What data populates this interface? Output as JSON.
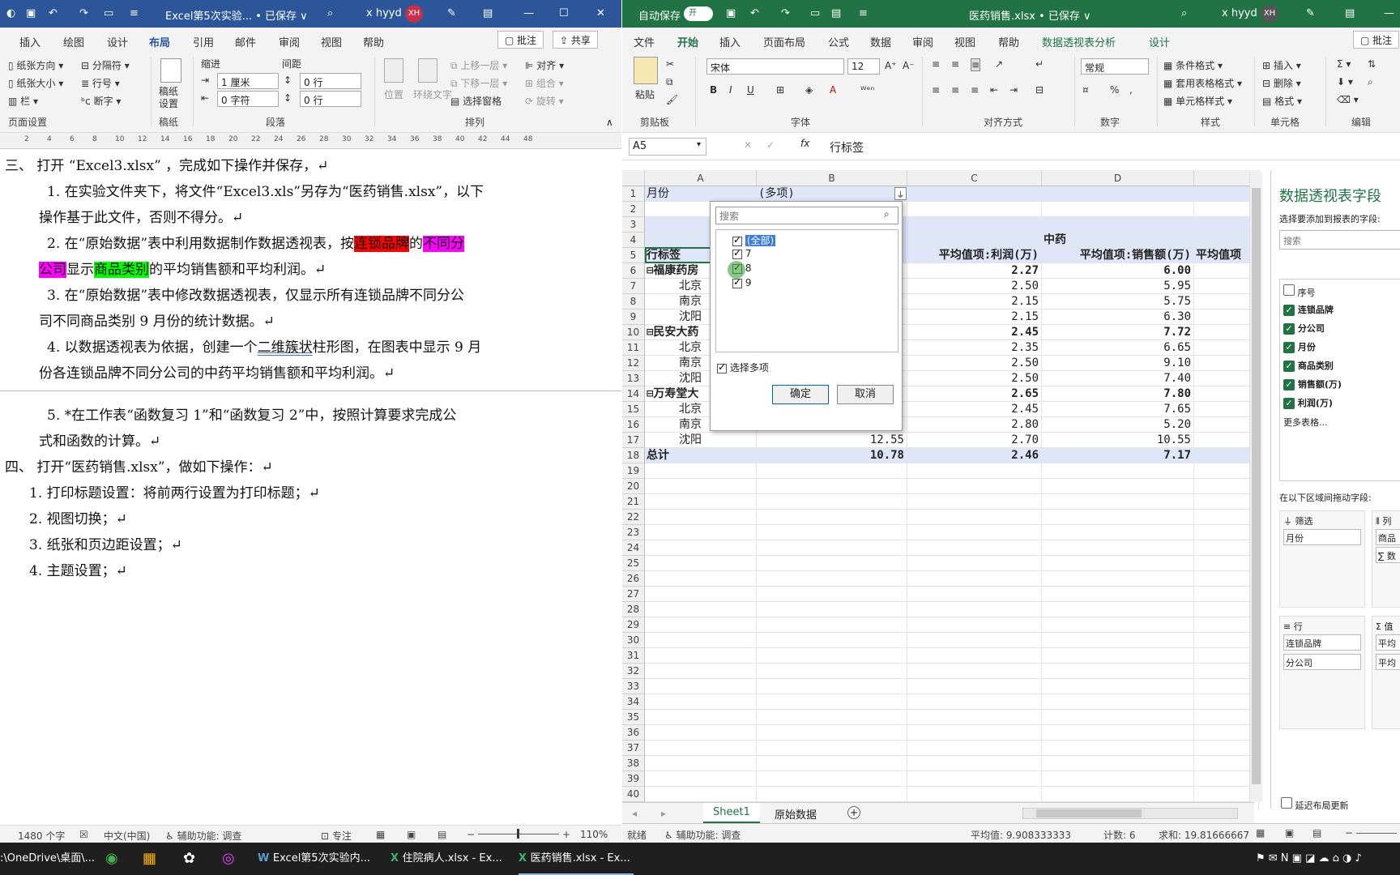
{
  "word": {
    "title": "Excel第5次实验... • 已保存 ∨",
    "user": "x hyyd",
    "avatar": "XH",
    "tabs": [
      "插入",
      "绘图",
      "设计",
      "布局",
      "引用",
      "邮件",
      "审阅",
      "视图",
      "帮助"
    ],
    "active_tab": "布局",
    "comment_btn": "批注",
    "share_btn": "共享",
    "ribbon": {
      "paper_orientation": "纸张方向",
      "paper_size": "纸张大小",
      "columns": "栏",
      "breaks": "分隔符",
      "line_numbers": "行号",
      "hyphenation": "断字",
      "manuscript": "稿纸设置",
      "indent": "缩进",
      "spacing": "间距",
      "indent_left": "1 厘米",
      "indent_right": "0 字符",
      "space_before": "0 行",
      "space_after": "0 行",
      "position": "位置",
      "wrap": "环绕文字",
      "bring_forward": "上移一层",
      "send_backward": "下移一层",
      "selection_pane": "选择窗格",
      "align": "对齐",
      "group": "组合",
      "rotate": "旋转",
      "groups": [
        "页面设置",
        "稿纸",
        "段落",
        "排列"
      ]
    },
    "ruler_ticks": [
      "2",
      "4",
      "6",
      "8",
      "10",
      "12",
      "14",
      "16",
      "18",
      "20",
      "22",
      "24",
      "26",
      "28",
      "30",
      "32",
      "34",
      "36",
      "38",
      "40",
      "42",
      "44",
      "48"
    ],
    "doc": {
      "l1": "三、   打开 “Excel3.xlsx” ，完成如下操作并保存，↵",
      "l2": "1.   在实验文件夹下，将文件“Excel3.xls”另存为“医药销售.xlsx”，以下",
      "l3": "操作基于此文件，否则不得分。↵",
      "l4a": "2.   在“原始数据”表中利用数据制作数据透视表，按",
      "l4b": "连锁品牌",
      "l4c": "的",
      "l4d": "不同分",
      "l5a": "公司",
      "l5b": "显示",
      "l5c": "商品类别",
      "l5d": "的平均销售额和平均利润。↵",
      "l6": "3.   在“原始数据”表中修改数据透视表，仅显示所有连锁品牌不同分公",
      "l7": "司不同商品类别 9 月份的统计数据。↵",
      "l8a": "4.   以数据透视表为依据，创建一个",
      "l8b": "二维簇状",
      "l8c": "柱形图，在图表中显示 9 月",
      "l9": "份各连锁品牌不同分公司的中药平均销售额和平均利润。↵",
      "l10": "5.   *在工作表“函数复习 1”和“函数复习 2”中，按照计算要求完成公",
      "l11": "式和函数的计算。↵",
      "l12": "四、   打开“医药销售.xlsx”，做如下操作：↵",
      "l13": "1.   打印标题设置：将前两行设置为打印标题；↵",
      "l14": "2.   视图切换；↵",
      "l15": "3.   纸张和页边距设置；↵",
      "l16": "4.   主题设置；↵"
    },
    "status": {
      "words": "1480 个字",
      "lang": "中文(中国)",
      "accessibility": "辅助功能: 调查",
      "focus": "专注",
      "zoom": "110%"
    }
  },
  "excel": {
    "autosave": "自动保存",
    "autosave_state": "开",
    "title": "医药销售.xlsx • 已保存 ∨",
    "user": "x hyyd",
    "avatar": "XH",
    "tabs": [
      "文件",
      "开始",
      "插入",
      "页面布局",
      "公式",
      "数据",
      "审阅",
      "视图",
      "帮助",
      "数据透视表分析",
      "设计"
    ],
    "active_tab": "开始",
    "comment_btn": "批注",
    "ribbon": {
      "paste": "粘贴",
      "clipboard": "剪贴板",
      "font_name": "宋体",
      "font_size": "12",
      "font_group": "字体",
      "align_group": "对齐方式",
      "number_format": "常规",
      "number_group": "数字",
      "cond_format": "条件格式",
      "table_format": "套用表格格式",
      "cell_style": "单元格样式",
      "style_group": "样式",
      "insert": "插入",
      "delete": "删除",
      "format": "格式",
      "cells_group": "单元格",
      "edit_group": "编辑"
    },
    "name_box": "A5",
    "formula": "行标签",
    "columns": [
      "A",
      "B",
      "C",
      "D"
    ],
    "rows": [
      "1",
      "2",
      "3",
      "4",
      "5",
      "6",
      "7",
      "8",
      "9",
      "10",
      "11",
      "12",
      "13",
      "14",
      "15",
      "16",
      "17",
      "18",
      "19",
      "20",
      "21",
      "22",
      "23",
      "24",
      "25",
      "26",
      "27",
      "28",
      "29",
      "30",
      "31",
      "32",
      "33",
      "34",
      "35",
      "36",
      "37",
      "38",
      "39",
      "40"
    ],
    "cells": {
      "a1": "月份",
      "b1": "(多项)",
      "d4": "中药",
      "a5": "行标签",
      "c5": "平均值项:利润(万)",
      "d5": "平均值项:销售额(万)",
      "e5": "平均值项",
      "a6": "⊟福康药房",
      "c6": "2.27",
      "d6": "6.00",
      "a7": "北京",
      "c7": "2.50",
      "d7": "5.95",
      "a8": "南京",
      "c8": "2.15",
      "d8": "5.75",
      "a9": "沈阳",
      "c9": "2.15",
      "d9": "6.30",
      "a10": "⊟民安大药",
      "c10": "2.45",
      "d10": "7.72",
      "a11": "北京",
      "c11": "2.35",
      "d11": "6.65",
      "a12": "南京",
      "c12": "2.50",
      "d12": "9.10",
      "a13": "沈阳",
      "c13": "2.50",
      "d13": "7.40",
      "a14": "⊟万寿堂大",
      "c14": "2.65",
      "d14": "7.80",
      "a15": "北京",
      "c15": "2.45",
      "d15": "7.65",
      "a16": "南京",
      "c16": "2.80",
      "d16": "5.20",
      "a17": "沈阳",
      "b17": "12.55",
      "c17": "2.70",
      "d17": "10.55",
      "a18": "总计",
      "b18": "10.78",
      "c18": "2.46",
      "d18": "7.17"
    },
    "filter": {
      "search_placeholder": "搜索",
      "items": [
        {
          "label": "(全部)",
          "checked": true
        },
        {
          "label": "7",
          "checked": true
        },
        {
          "label": "8",
          "checked": true
        },
        {
          "label": "9",
          "checked": true
        }
      ],
      "multi_select": "选择多项",
      "ok": "确定",
      "cancel": "取消"
    },
    "sheets": [
      "Sheet1",
      "原始数据"
    ],
    "active_sheet": "Sheet1",
    "pivot_pane": {
      "title": "数据透视表字段",
      "subtitle": "选择要添加到报表的字段:",
      "search": "搜索",
      "fields": [
        {
          "label": "序号",
          "checked": false
        },
        {
          "label": "连锁品牌",
          "checked": true
        },
        {
          "label": "分公司",
          "checked": true
        },
        {
          "label": "月份",
          "checked": true
        },
        {
          "label": "商品类别",
          "checked": true
        },
        {
          "label": "销售额(万)",
          "checked": true
        },
        {
          "label": "利润(万)",
          "checked": true
        }
      ],
      "more": "更多表格...",
      "drag_hint": "在以下区域间拖动字段:",
      "filter_label": "筛选",
      "filter_item": "月份",
      "col_label": "列",
      "col_item1": "商品",
      "col_item2": "∑ 数",
      "row_label": "行",
      "row_item1": "连锁品牌",
      "row_item2": "分公司",
      "val_label": "值",
      "val_item1": "平均",
      "val_item2": "平均",
      "defer": "延迟布局更新"
    },
    "status": {
      "ready": "就绪",
      "accessibility": "辅助功能: 调查",
      "average": "平均值: 9.908333333",
      "count": "计数: 6",
      "sum": "求和: 19.81666667"
    }
  },
  "taskbar": {
    "path": ":\\OneDrive\\桌面\\...",
    "apps": [
      "Excel第5次实验内...",
      "住院病人.xlsx - Ex...",
      "医药销售.xlsx - Ex..."
    ]
  }
}
